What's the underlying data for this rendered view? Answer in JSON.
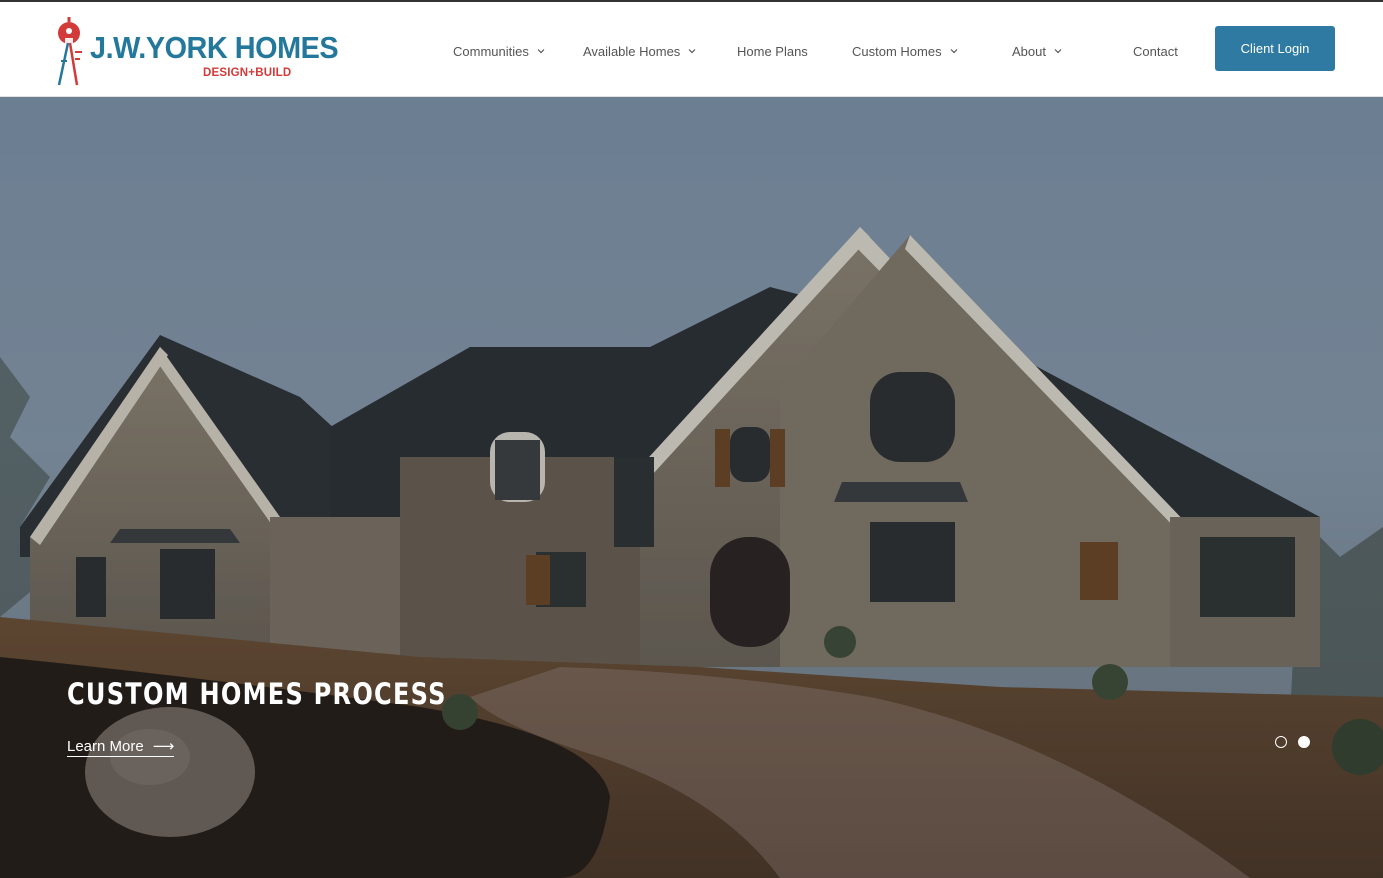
{
  "brand": {
    "name": "J.W.YORK HOMES",
    "tagline": "DESIGN+BUILD",
    "primary_color": "#23789b",
    "accent_color": "#d33a3a"
  },
  "nav": {
    "items": [
      {
        "label": "Communities",
        "has_dropdown": true,
        "icon": "chevron-down-icon"
      },
      {
        "label": "Available Homes",
        "has_dropdown": true,
        "icon": "chevron-down-icon"
      },
      {
        "label": "Home Plans",
        "has_dropdown": false
      },
      {
        "label": "Custom Homes",
        "has_dropdown": true,
        "icon": "chevron-down-icon"
      },
      {
        "label": "About",
        "has_dropdown": true,
        "icon": "chevron-down-icon"
      },
      {
        "label": "Contact",
        "has_dropdown": false
      }
    ],
    "cta": {
      "label": "Client Login",
      "color": "#2e7aa3"
    }
  },
  "hero": {
    "title": "CUSTOM HOMES PROCESS",
    "link_label": "Learn More",
    "link_icon": "arrow-right-icon",
    "slides_total": 2,
    "active_slide": 2
  }
}
